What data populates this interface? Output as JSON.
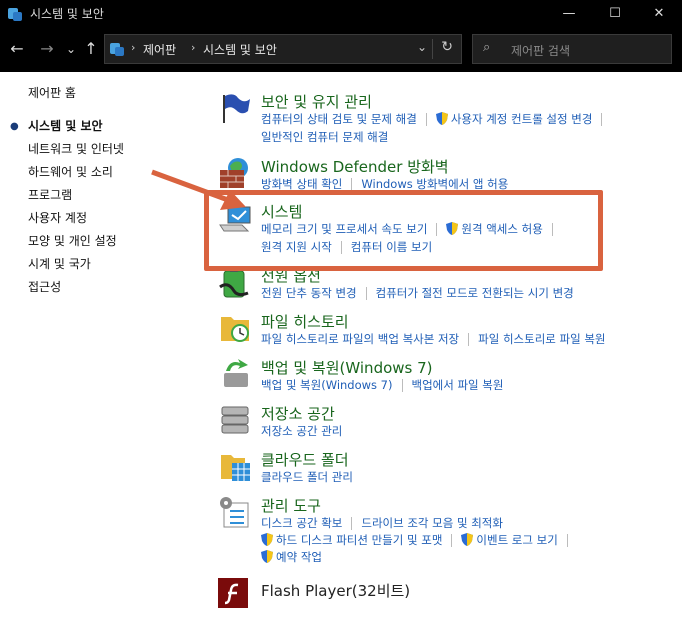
{
  "window": {
    "title": "시스템 및 보안",
    "minimize": "—",
    "maximize": "☐",
    "close": "✕"
  },
  "nav": {
    "back": "←",
    "forward": "→",
    "recent": "⌄",
    "up": "↑"
  },
  "address": {
    "sep1": "›",
    "crumb1": "제어판",
    "sep2": "›",
    "crumb2": "시스템 및 보안",
    "dropdown": "⌄",
    "refresh": "↻"
  },
  "search": {
    "icon": "⌕",
    "placeholder": "제어판 검색"
  },
  "sidebar": {
    "bullet": "●",
    "items": [
      {
        "label": "제어판 홈"
      },
      {
        "label": "시스템 및 보안"
      },
      {
        "label": "네트워크 및 인터넷"
      },
      {
        "label": "하드웨어 및 소리"
      },
      {
        "label": "프로그램"
      },
      {
        "label": "사용자 계정"
      },
      {
        "label": "모양 및 개인 설정"
      },
      {
        "label": "시계 및 국가"
      },
      {
        "label": "접근성"
      }
    ]
  },
  "categories": [
    {
      "title": "보안 및 유지 관리",
      "rows": [
        [
          "컴퓨터의 상태 검토 및 문제 해결",
          "사용자 계정 컨트롤 설정 변경"
        ],
        [
          "일반적인 컴퓨터 문제 해결"
        ]
      ]
    },
    {
      "title": "Windows Defender 방화벽",
      "rows": [
        [
          "방화벽 상태 확인",
          "Windows 방화벽에서 앱 허용"
        ]
      ]
    },
    {
      "title": "시스템",
      "rows": [
        [
          "메모리 크기 및 프로세서 속도 보기",
          "원격 액세스 허용"
        ],
        [
          "원격 지원 시작",
          "컴퓨터 이름 보기"
        ]
      ]
    },
    {
      "title": "전원 옵션",
      "rows": [
        [
          "전원 단추 동작 변경",
          "컴퓨터가 절전 모드로 전환되는 시기 변경"
        ]
      ]
    },
    {
      "title": "파일 히스토리",
      "rows": [
        [
          "파일 히스토리로 파일의 백업 복사본 저장",
          "파일 히스토리로 파일 복원"
        ]
      ]
    },
    {
      "title": "백업 및 복원(Windows 7)",
      "rows": [
        [
          "백업 및 복원(Windows 7)",
          "백업에서 파일 복원"
        ]
      ]
    },
    {
      "title": "저장소 공간",
      "rows": [
        [
          "저장소 공간 관리"
        ]
      ]
    },
    {
      "title": "클라우드 폴더",
      "rows": [
        [
          "클라우드 폴더 관리"
        ]
      ]
    },
    {
      "title": "관리 도구",
      "rows": [
        [
          "디스크 공간 확보",
          "드라이브 조각 모음 및 최적화"
        ],
        [
          "하드 디스크 파티션 만들기 및 포맷",
          "이벤트 로그 보기"
        ],
        [
          "예약 작업"
        ]
      ]
    },
    {
      "title": "Flash Player(32비트)",
      "rows": []
    }
  ],
  "colors": {
    "category_title": "#19661d",
    "link": "#1f5eb6",
    "highlight": "#d9633f",
    "chrome": "#000000"
  }
}
